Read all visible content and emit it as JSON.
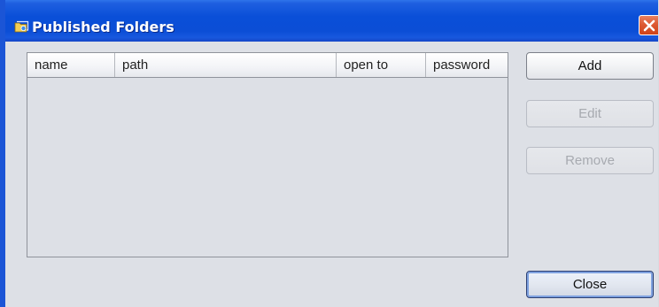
{
  "window": {
    "title": "Published Folders",
    "colors": {
      "titlebar": "#0b4ed6",
      "body": "#dde0e6",
      "close_button": "#dd5a33"
    }
  },
  "table": {
    "columns": [
      "name",
      "path",
      "open to",
      "password"
    ],
    "rows": []
  },
  "buttons": {
    "add": "Add",
    "edit": "Edit",
    "remove": "Remove",
    "close": "Close"
  }
}
